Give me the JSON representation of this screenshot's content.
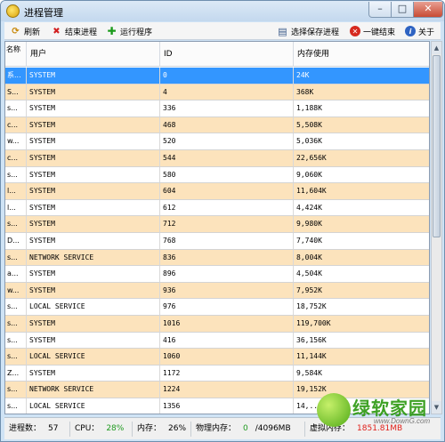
{
  "window": {
    "title": "进程管理",
    "minimize_glyph": "–",
    "maximize_glyph": "□",
    "close_glyph": "✕"
  },
  "toolbar": {
    "refresh_label": "刷新",
    "end_process_label": "结束进程",
    "run_program_label": "运行程序",
    "choose_save_label": "选择保存进程",
    "one_click_end_label": "一键结束",
    "about_label": "关于",
    "icons": [
      "refresh-icon",
      "end-process-icon",
      "run-program-icon",
      "save-icon",
      "one-click-end-icon",
      "about-icon"
    ]
  },
  "table": {
    "headers": {
      "name": "名称",
      "user": "用户",
      "id": "ID",
      "memory": "内存使用"
    },
    "rows": [
      {
        "name": "系...",
        "user": "SYSTEM",
        "id": "0",
        "memory": "24K"
      },
      {
        "name": "S...",
        "user": "SYSTEM",
        "id": "4",
        "memory": "368K"
      },
      {
        "name": "s...",
        "user": "SYSTEM",
        "id": "336",
        "memory": "1,188K"
      },
      {
        "name": "c...",
        "user": "SYSTEM",
        "id": "468",
        "memory": "5,508K"
      },
      {
        "name": "w...",
        "user": "SYSTEM",
        "id": "520",
        "memory": "5,036K"
      },
      {
        "name": "c...",
        "user": "SYSTEM",
        "id": "544",
        "memory": "22,656K"
      },
      {
        "name": "s...",
        "user": "SYSTEM",
        "id": "580",
        "memory": "9,060K"
      },
      {
        "name": "l...",
        "user": "SYSTEM",
        "id": "604",
        "memory": "11,604K"
      },
      {
        "name": "l...",
        "user": "SYSTEM",
        "id": "612",
        "memory": "4,424K"
      },
      {
        "name": "s...",
        "user": "SYSTEM",
        "id": "712",
        "memory": "9,980K"
      },
      {
        "name": "D...",
        "user": "SYSTEM",
        "id": "768",
        "memory": "7,740K"
      },
      {
        "name": "s...",
        "user": "NETWORK SERVICE",
        "id": "836",
        "memory": "8,004K"
      },
      {
        "name": "a...",
        "user": "SYSTEM",
        "id": "896",
        "memory": "4,504K"
      },
      {
        "name": "w...",
        "user": "SYSTEM",
        "id": "936",
        "memory": "7,952K"
      },
      {
        "name": "s...",
        "user": "LOCAL SERVICE",
        "id": "976",
        "memory": "18,752K"
      },
      {
        "name": "s...",
        "user": "SYSTEM",
        "id": "1016",
        "memory": "119,700K"
      },
      {
        "name": "s...",
        "user": "SYSTEM",
        "id": "416",
        "memory": "36,156K"
      },
      {
        "name": "s...",
        "user": "LOCAL SERVICE",
        "id": "1060",
        "memory": "11,144K"
      },
      {
        "name": "Z...",
        "user": "SYSTEM",
        "id": "1172",
        "memory": "9,584K"
      },
      {
        "name": "s...",
        "user": "NETWORK SERVICE",
        "id": "1224",
        "memory": "19,152K"
      },
      {
        "name": "s...",
        "user": "LOCAL SERVICE",
        "id": "1356",
        "memory": "14,..."
      }
    ],
    "selected_index": 0
  },
  "status": {
    "process_count_label": "进程数：",
    "process_count": "57",
    "cpu_label": "CPU：",
    "cpu_value": "28%",
    "memory_label": "内存：",
    "memory_value": "26%",
    "physical_label": "物理内存：",
    "physical_value": "0",
    "physical_total": "/4096MB",
    "virtual_label": "虚拟内存：",
    "virtual_value": "1851.81MB"
  },
  "watermark": {
    "title": "绿软家园",
    "url": "www.DownG.com"
  },
  "colors": {
    "row_alt": "#fce3bc",
    "row_selected": "#3396ff",
    "cpu_value": "#1f9a1f",
    "virtual_value": "#e0201a"
  }
}
